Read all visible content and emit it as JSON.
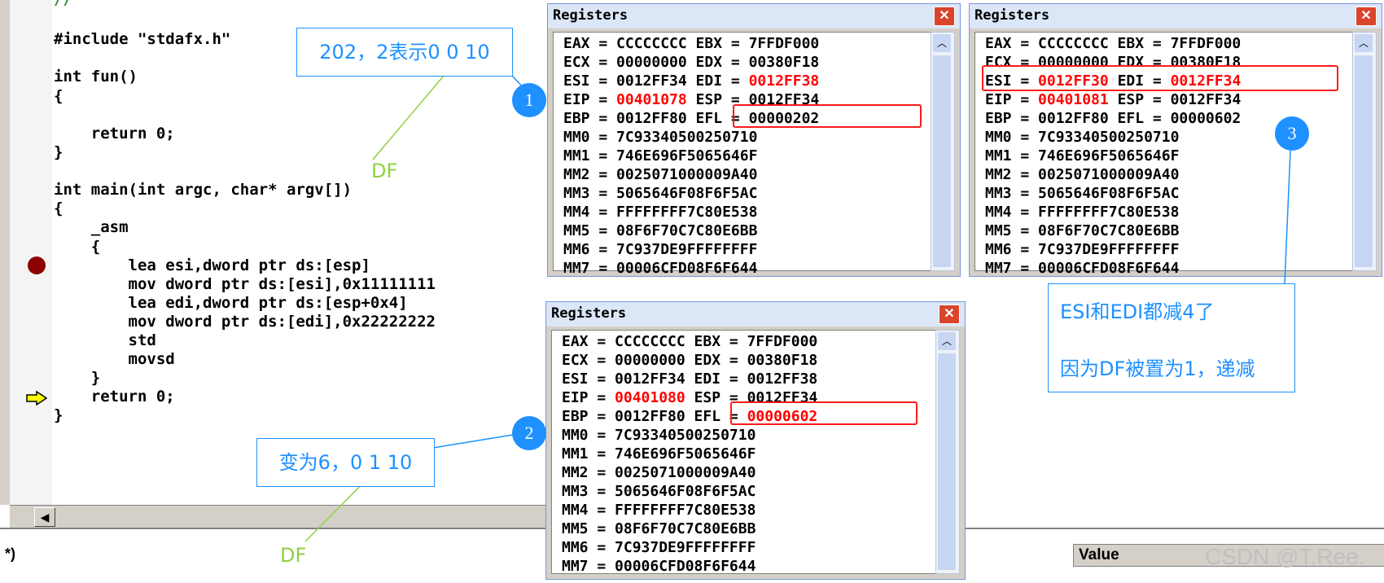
{
  "editor": {
    "code_lines": [
      {
        "text": "//",
        "style": "cm"
      },
      {
        "text": "#include \"stdafx.h\""
      },
      {
        "text": ""
      },
      {
        "text": "int fun()"
      },
      {
        "text": "{"
      },
      {
        "text": ""
      },
      {
        "text": "    return 0;"
      },
      {
        "text": "}"
      },
      {
        "text": ""
      },
      {
        "text": "int main(int argc, char* argv[])"
      },
      {
        "text": "{"
      },
      {
        "text": "    _asm"
      },
      {
        "text": "    {"
      },
      {
        "text": "        lea esi,dword ptr ds:[esp]"
      },
      {
        "text": "        mov dword ptr ds:[esi],0x11111111"
      },
      {
        "text": "        lea edi,dword ptr ds:[esp+0x4]"
      },
      {
        "text": "        mov dword ptr ds:[edi],0x22222222"
      },
      {
        "text": "        std"
      },
      {
        "text": "        movsd"
      },
      {
        "text": "    }"
      },
      {
        "text": "    return 0;"
      },
      {
        "text": "}"
      }
    ]
  },
  "bottom": {
    "left_label": "*)",
    "value_header": "Value",
    "watermark": "CSDN @T.Ree."
  },
  "register_windows": [
    {
      "title": "Registers",
      "rows": [
        [
          {
            "t": "EAX = CCCCCCCC EBX = 7FFDF000"
          }
        ],
        [
          {
            "t": "ECX = 00000000 EDX = 00380F18"
          }
        ],
        [
          {
            "t": "ESI = 0012FF34 EDI = "
          },
          {
            "t": "0012FF38",
            "red": true
          }
        ],
        [
          {
            "t": "EIP = "
          },
          {
            "t": "00401078",
            "red": true
          },
          {
            "t": " ESP = 0012FF34"
          }
        ],
        [
          {
            "t": "EBP = 0012FF80 EFL = 00000202"
          }
        ],
        [
          {
            "t": "MM0 = 7C93340500250710"
          }
        ],
        [
          {
            "t": "MM1 = 746E696F5065646F"
          }
        ],
        [
          {
            "t": "MM2 = 0025071000009A40"
          }
        ],
        [
          {
            "t": "MM3 = 5065646F08F6F5AC"
          }
        ],
        [
          {
            "t": "MM4 = FFFFFFFF7C80E538"
          }
        ],
        [
          {
            "t": "MM5 = 08F6F70C7C80E6BB"
          }
        ],
        [
          {
            "t": "MM6 = 7C937DE9FFFFFFFF"
          }
        ],
        [
          {
            "t": "MM7 = 00006CFD08F6F644"
          }
        ]
      ]
    },
    {
      "title": "Registers",
      "rows": [
        [
          {
            "t": "EAX = CCCCCCCC EBX = 7FFDF000"
          }
        ],
        [
          {
            "t": "ECX = 00000000 EDX = 00380F18"
          }
        ],
        [
          {
            "t": "ESI = 0012FF34 EDI = 0012FF38"
          }
        ],
        [
          {
            "t": "EIP = "
          },
          {
            "t": "00401080",
            "red": true
          },
          {
            "t": " ESP = 0012FF34"
          }
        ],
        [
          {
            "t": "EBP = 0012FF80 EFL = "
          },
          {
            "t": "00000602",
            "red": true
          }
        ],
        [
          {
            "t": "MM0 = 7C93340500250710"
          }
        ],
        [
          {
            "t": "MM1 = 746E696F5065646F"
          }
        ],
        [
          {
            "t": "MM2 = 0025071000009A40"
          }
        ],
        [
          {
            "t": "MM3 = 5065646F08F6F5AC"
          }
        ],
        [
          {
            "t": "MM4 = FFFFFFFF7C80E538"
          }
        ],
        [
          {
            "t": "MM5 = 08F6F70C7C80E6BB"
          }
        ],
        [
          {
            "t": "MM6 = 7C937DE9FFFFFFFF"
          }
        ],
        [
          {
            "t": "MM7 = 00006CFD08F6F644"
          }
        ]
      ]
    },
    {
      "title": "Registers",
      "rows": [
        [
          {
            "t": "EAX = CCCCCCCC EBX = 7FFDF000"
          }
        ],
        [
          {
            "t": "ECX = 00000000 EDX = 00380F18"
          }
        ],
        [
          {
            "t": "ESI = "
          },
          {
            "t": "0012FF30",
            "red": true
          },
          {
            "t": " EDI = "
          },
          {
            "t": "0012FF34",
            "red": true
          }
        ],
        [
          {
            "t": "EIP = "
          },
          {
            "t": "00401081",
            "red": true
          },
          {
            "t": " ESP = 0012FF34"
          }
        ],
        [
          {
            "t": "EBP = 0012FF80 EFL = 00000602"
          }
        ],
        [
          {
            "t": "MM0 = 7C93340500250710"
          }
        ],
        [
          {
            "t": "MM1 = 746E696F5065646F"
          }
        ],
        [
          {
            "t": "MM2 = 0025071000009A40"
          }
        ],
        [
          {
            "t": "MM3 = 5065646F08F6F5AC"
          }
        ],
        [
          {
            "t": "MM4 = FFFFFFFF7C80E538"
          }
        ],
        [
          {
            "t": "MM5 = 08F6F70C7C80E6BB"
          }
        ],
        [
          {
            "t": "MM6 = 7C937DE9FFFFFFFF"
          }
        ],
        [
          {
            "t": "MM7 = 00006CFD08F6F644"
          }
        ]
      ]
    }
  ],
  "annotations": {
    "note1": "202，2表示0 0  10",
    "note2": "变为6，0 1  10",
    "note3_line1": "ESI和EDI都减4了",
    "note3_line2": "因为DF被置为1，递减",
    "df1": "DF",
    "df2": "DF",
    "badge1": "1",
    "badge2": "2",
    "badge3": "3"
  },
  "colors": {
    "annotation_blue": "#1e90ff",
    "df_green": "#90d040",
    "highlight_red": "#ff1a1a"
  }
}
